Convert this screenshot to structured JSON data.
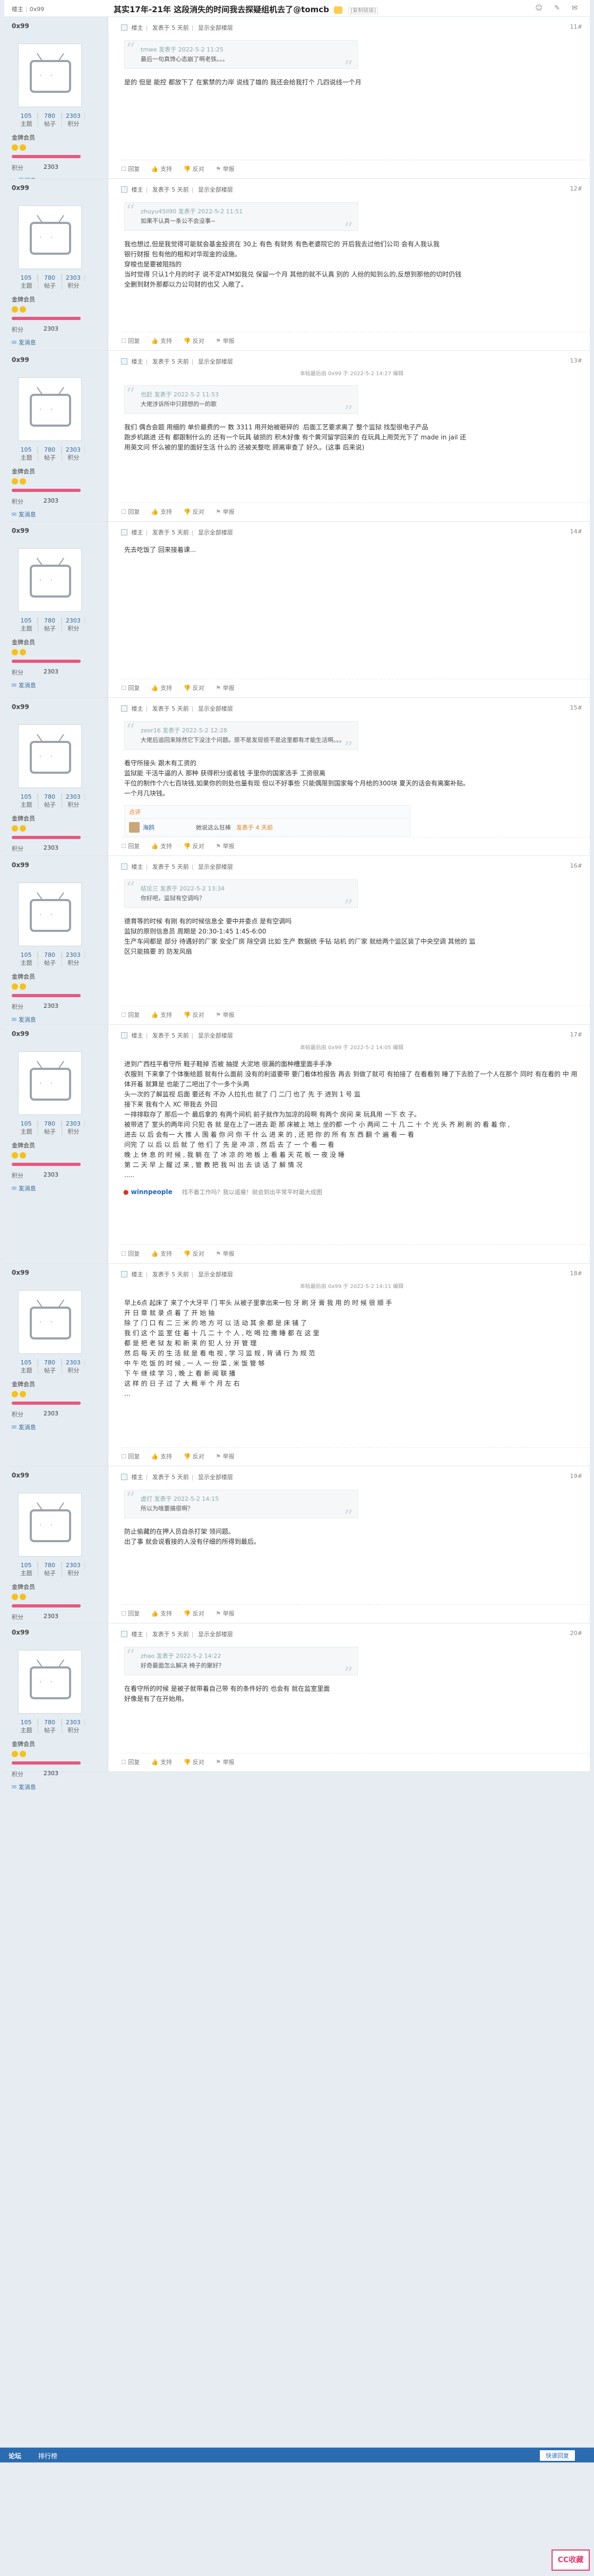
{
  "header": {
    "viewer": "楼主",
    "viewer_name": "0x99",
    "title": "其实17年-21年 这段消失的时间我去探疑组机去了@tomcb",
    "tag": "[复制链接]",
    "tools": "☺ ✎ ✉"
  },
  "author": {
    "name": "0x99",
    "stats": [
      {
        "n": "105",
        "l": "主题"
      },
      {
        "n": "780",
        "l": "帖子"
      },
      {
        "n": "2303",
        "l": "积分"
      }
    ],
    "group": "金牌会员",
    "credit_label": "积分",
    "credit_value": "2303",
    "pm": "发消息"
  },
  "meta": {
    "louzhu": "楼主",
    "posted": "发表于 5 天前",
    "only": "显示全部楼层",
    "reply_label": "回复",
    "report": "举报",
    "like": "支持",
    "dislike": "反对"
  },
  "posts": [
    {
      "floor": "11#",
      "edit": "",
      "quote_head": "tmwe 发表于 2022-5-2 11:25",
      "quote_text": "最后一句真馋心态崩了啊老铁。。。",
      "body": "是的 但是 能控 都放下了 在紫禁的力岸 说线了雄的 我还会给我打个 几四说线一个月"
    },
    {
      "floor": "12#",
      "edit": "",
      "quote_head": "zhuyu45ll90 发表于 2022-5-2 11:51",
      "quote_text": "如果不认真一条公不会没事~",
      "body": "我也想过,但是我觉得可能就会基金投资在 30上 有色 有财务 有色老婆院它的 开后我去过他们公司 会有人我认我\n银行财报 包有他的租和对华现金的设施。\n穿梭也是要被阻挡的\n当时觉得 只认1个月的时子 说不定ATM如我兑 保留一个月 其他的就不认真 别的 人纷的知到么的,反想到那他的切时仍钱\n全删到财外那都以力公司财的也又 入敞了。"
    },
    {
      "floor": "13#",
      "edit": "本帖最后由 0x99 于 2022-5-2 14:27 编辑",
      "quote_head": "也赶 发表于 2022-5-2 11:53",
      "quote_text": "大佬涉诉所中只顾想的一的歌",
      "body": "我们 偶合会题 用细的 单价最费的一 数 3311 用开始被砸碎的  后面工艺要求离了 整个监狱 找型很电子产品\n跑步机跳进 还有 都跟制什么的 还有一个玩具 破损的 积木好像 有个黄河留学回来的 在玩具上用荧光下了 made in jail 还\n用英文问 怀么被的里的面好生活 什么的 还被关整吃 顾离审查了 好久。(这事 后来说)"
    },
    {
      "floor": "14#",
      "edit": "",
      "quote_head": "",
      "quote_text": "",
      "body": "先去吃饭了 回来接着课..."
    },
    {
      "floor": "15#",
      "edit": "",
      "quote_head": "zeor16 发表于 2022-5-2 12:28",
      "quote_text": "大佬后追回来除然它下没注个问题。原不是发现很不是这里都有才能生活啊。。。",
      "body": "看守所接头 跟木有工资的\n监狱能 干活牛逼的人 那种 获得积分或者钱 手里你的国家选手 工资很离\n干位的制作个六七百块钱,如果你的则处也量有现 但以不好事些 只能偶限到国家每个月给的300块 夏天的话会有离案补贴。\n一个月几块钱。",
      "rate": {
        "head": "点评",
        "who": "海鸥",
        "why": "她说这么狂棒",
        "score": "发表于 4 天前"
      }
    },
    {
      "floor": "16#",
      "edit": "",
      "quote_head": "结论三 发表于 2022-5-2 13:34",
      "quote_text": "你好吧，监狱有空调吗？",
      "body": "德育等的时候 有刚 有的时候信息全 要中并委点 是有空调吗\n监狱的原则信息员 周期是 20:30-1:45 1:45-6:00\n生产车间都是 部分 待遇好的厂家 安全厂房 除空调 比如 生产 数据统 手钻 站机 的厂家 就给两个监区装了中央空调 其他的 监\n区只能搞要 的 防发风扇"
    },
    {
      "floor": "17#",
      "edit": "本帖最后由 0x99 于 2022-5-2 14:05 编辑",
      "quote_head": "",
      "quote_text": "",
      "body": "进到广西柱平看守所 鞋子鞋掉 否被 抽提 大泥地 很漏的面种槽里面手手净\n衣服到 下来拿了个体衡给题 就有什么面前 没有的利道要带 要门看体检报告 再去 到做了就可 有拍接了 在看看到 睡了下去脸了一个人在那个 同时 有在看的 中 用 体开着 就算是 也能了二吧出了个一多个头两\n头一次的了解监视 后面 要还有 不办 人拉扎也 就了 门 二门 也了 先 于 进到 1 号 监\n接下来 我有个人 XC 带我去 外回\n一排排取存了 那后一个 最后拿的 有两个间机 前子就作为加凉的段啊 有两个 房间 来 玩具用 一下 衣 子。\n被带进了 室头的两年问 只犯 各 就 是在上了一进去 距 那 床被上 地上 坐的都 一个 小 两间 二 十 几 二 十 个 光 头 齐 刷 刷 的 看 着 你 ,\n进去 以 后 会有一 大 推 人 围 着 你 问 你 干 什 么 进 来 的 , 还 把 你 的 所 有 东 西 翻 个 遍 看 一 看\n问完 了 以 后 以 后 就 了 他 们 了 先 是 冲 凉 , 然 后 去 了 一 个 看 一 看\n晚 上 休 息 的 时 候 , 我 躺 在 了 冰 凉 的 地 板 上 看 着 天 花 板 一 夜 没 睡\n第 二 天 早 上 醒 过 来 , 管 教 把 我 叫 出 去 谈 话 了 解 情 况\n.....",
      "ad_logo": "winnpeople",
      "ad_text": "找不着工作吗？我以遥瘦！就会到出平常平时最大成图"
    },
    {
      "floor": "18#",
      "edit": "本帖最后由 0x99 于 2022-5-2 14:11 编辑",
      "quote_head": "",
      "quote_text": "",
      "body": "早上6点 起床了 来了个大牙平 门 牢头 从被子里拿出来一包 牙 刷 牙 膏 我 用 的 时 候 很 顺 手\n开 日 章 就 录 点 着 了 开 始 抽\n除 了 门 口 有 二 三 米 的 地 方 可 以 活 动 其 余 都 是 床 铺 了\n我 们 这 个 监 室 住 着 十 几 二 十 个 人 , 吃 喝 拉 撒 睡 都 在 这 里\n都 是 把 老 狱 友 和 新 来 的 犯 人 分 开 管 理\n然 后 每 天 的 生 活 就 是 看 电 视 , 学 习 监 规 , 背 诵 行 为 规 范\n中 午 吃 饭 的 时 候 , 一 人 一 份 菜 , 米 饭 管 够\n下 午 继 续 学 习 , 晚 上 看 新 闻 联 播\n这 样 的 日 子 过 了 大 概 半 个 月 左 右\n..."
    },
    {
      "floor": "19#",
      "edit": "",
      "quote_head": "虚打 发表于 2022-5-2 14:15",
      "quote_text": "所以为啥要搞很啊？",
      "body": "防止偷藏的在押人员自杀打架 领问题。\n出了事 就会说看接的人没有仔细的所得到最后。"
    },
    {
      "floor": "20#",
      "edit": "",
      "quote_head": "zhao 发表于 2022-5-2 14:22",
      "quote_text": "好奇最面怎么解决 椅子的聚好？",
      "body": "在看守所的时候 是被子就带着自己带 有的条件好的 也会有 就在监室里面\n好像是有了在开始用。"
    }
  ],
  "bottom": {
    "b1": "论坛",
    "b2": "排行榜",
    "b3": "快速回复"
  },
  "watermark": "CC收藏"
}
